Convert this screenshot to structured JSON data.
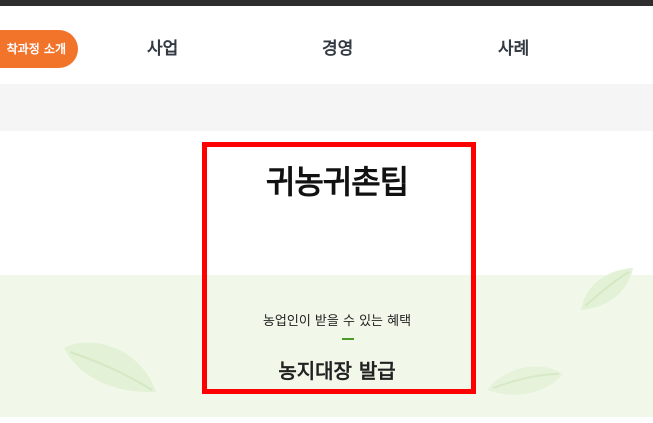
{
  "header": {
    "pill_label": "착과정 소개",
    "nav_items": [
      "사업",
      "경영",
      "사례"
    ]
  },
  "main": {
    "title": "귀농귀촌팁",
    "subtitle": "농업인이 받을 수 있는 혜택",
    "heading": "농지대장 발급"
  },
  "colors": {
    "accent_pill": "#f2732a",
    "divider": "#4a9b2a",
    "highlight_border": "#ff0000",
    "band_bg": "#f1f8ea"
  },
  "icons": [
    "leaf-icon"
  ]
}
